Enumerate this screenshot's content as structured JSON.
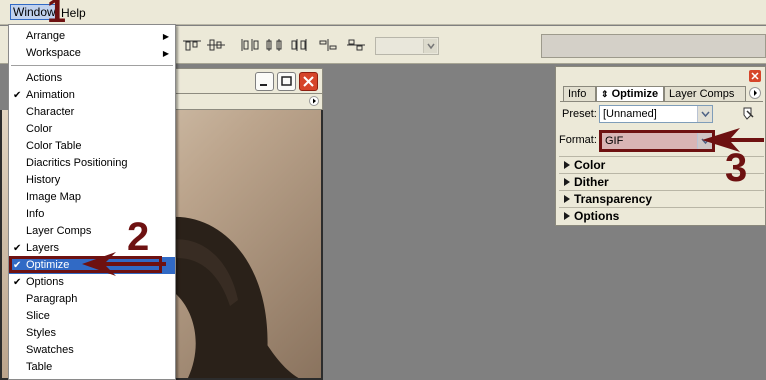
{
  "menubar": {
    "window": "Window",
    "help": "Help"
  },
  "window_menu": {
    "items": [
      {
        "label": "Arrange",
        "checked": false,
        "submenu": true
      },
      {
        "label": "Workspace",
        "checked": false,
        "submenu": true
      },
      {
        "label": "Actions",
        "checked": false
      },
      {
        "label": "Animation",
        "checked": true
      },
      {
        "label": "Character",
        "checked": false
      },
      {
        "label": "Color",
        "checked": false
      },
      {
        "label": "Color Table",
        "checked": false
      },
      {
        "label": "Diacritics Positioning",
        "checked": false
      },
      {
        "label": "History",
        "checked": false
      },
      {
        "label": "Image Map",
        "checked": false
      },
      {
        "label": "Info",
        "checked": false
      },
      {
        "label": "Layer Comps",
        "checked": false
      },
      {
        "label": "Layers",
        "checked": true
      },
      {
        "label": "Optimize",
        "checked": true,
        "highlighted": true
      },
      {
        "label": "Options",
        "checked": true
      },
      {
        "label": "Paragraph",
        "checked": false
      },
      {
        "label": "Slice",
        "checked": false
      },
      {
        "label": "Styles",
        "checked": false
      },
      {
        "label": "Swatches",
        "checked": false
      },
      {
        "label": "Table",
        "checked": false
      }
    ]
  },
  "optimize_panel": {
    "tabs": [
      "Info",
      "Optimize",
      "Layer Comps"
    ],
    "active_tab": "Optimize",
    "preset_label": "Preset:",
    "preset_value": "[Unnamed]",
    "format_label": "Format:",
    "format_value": "GIF",
    "sections": [
      "Color",
      "Dither",
      "Transparency",
      "Options"
    ]
  },
  "annotations": {
    "step1": "1",
    "step2": "2",
    "step3": "3"
  },
  "colors": {
    "annotation": "#6e1111",
    "menu_highlight": "#316ac5",
    "annotation_box_fill": "#d9b5b5"
  }
}
